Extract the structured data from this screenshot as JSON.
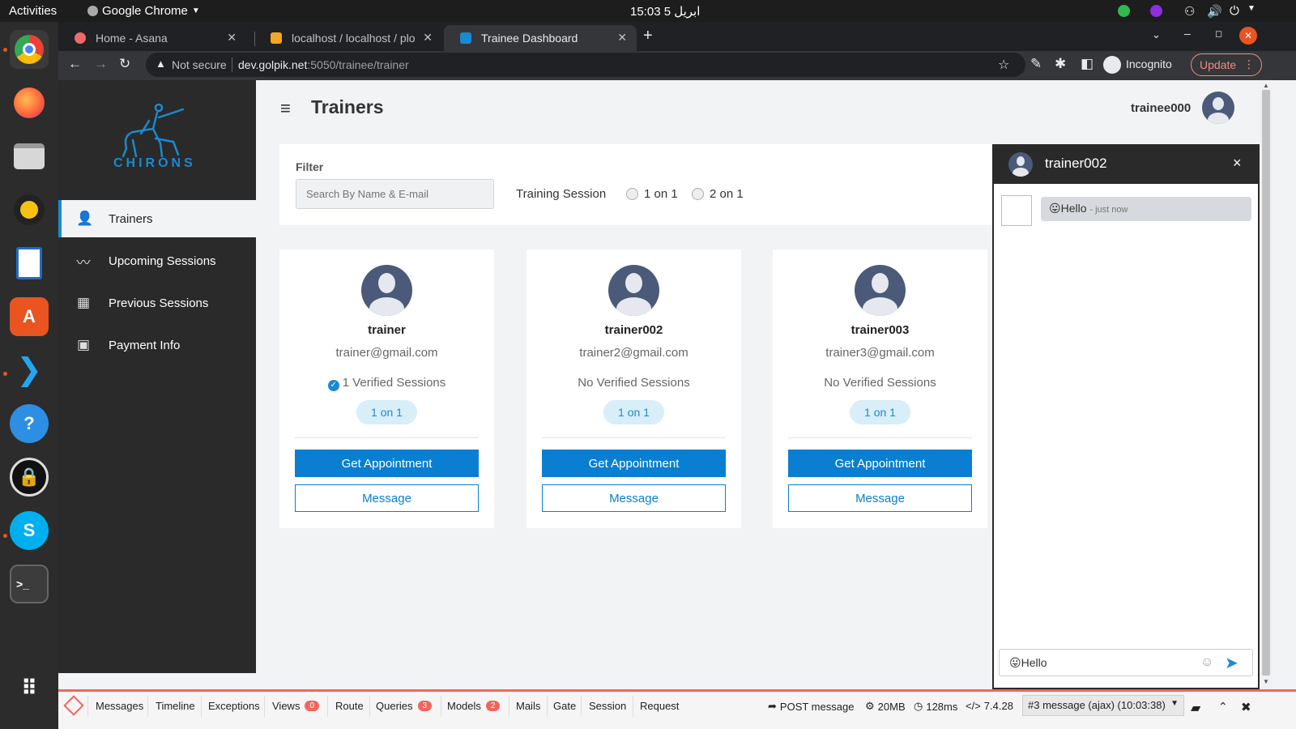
{
  "os": {
    "activities": "Activities",
    "app_menu": "Google Chrome",
    "clock": "15:03  5 ابریل"
  },
  "browser": {
    "tabs": [
      {
        "title": "Home - Asana"
      },
      {
        "title": "localhost / localhost / plo"
      },
      {
        "title": "Trainee Dashboard"
      }
    ],
    "security": "Not secure",
    "url_host": "dev.golpik.net",
    "url_path": ":5050/trainee/trainer",
    "incognito": "Incognito",
    "update": "Update"
  },
  "app": {
    "logo_text": "CHIRONS",
    "page_title": "Trainers",
    "username": "trainee000",
    "nav": [
      {
        "label": "Trainers",
        "icon": "user-icon"
      },
      {
        "label": "Upcoming Sessions",
        "icon": "trend-icon"
      },
      {
        "label": "Previous Sessions",
        "icon": "calendar-icon"
      },
      {
        "label": "Payment Info",
        "icon": "wallet-icon"
      }
    ],
    "filter": {
      "label": "Filter",
      "search_placeholder": "Search By Name & E-mail",
      "session_label": "Training Session",
      "options": [
        "1 on 1",
        "2 on 1"
      ]
    },
    "trainers": [
      {
        "name": "trainer",
        "email": "trainer@gmail.com",
        "verified": "1 Verified Sessions",
        "is_verified": true,
        "tag": "1 on 1",
        "appointment": "Get Appointment",
        "message": "Message"
      },
      {
        "name": "trainer002",
        "email": "trainer2@gmail.com",
        "verified": "No Verified Sessions",
        "is_verified": false,
        "tag": "1 on 1",
        "appointment": "Get Appointment",
        "message": "Message"
      },
      {
        "name": "trainer003",
        "email": "trainer3@gmail.com",
        "verified": "No Verified Sessions",
        "is_verified": false,
        "tag": "1 on 1",
        "appointment": "Get Appointment",
        "message": "Message"
      }
    ],
    "chat": {
      "title": "trainer002",
      "close": "×",
      "message_text": "😛Hello",
      "message_time": "- just now",
      "input_value": "😛Hello"
    }
  },
  "debugbar": {
    "items": [
      "Messages",
      "Timeline",
      "Exceptions",
      "Views",
      "Route",
      "Queries",
      "Models",
      "Mails",
      "Gate",
      "Session",
      "Request"
    ],
    "badges": {
      "views": "0",
      "queries": "3",
      "models": "2"
    },
    "request": "POST message",
    "memory": "20MB",
    "time": "128ms",
    "php": "7.4.28",
    "select": "#3 message (ajax) (10:03:38)"
  },
  "colors": {
    "accent": "#0a7fd1",
    "sidebar": "#2a2a2a",
    "debug_red": "#f4645f",
    "dock": "#2c2c2c"
  }
}
